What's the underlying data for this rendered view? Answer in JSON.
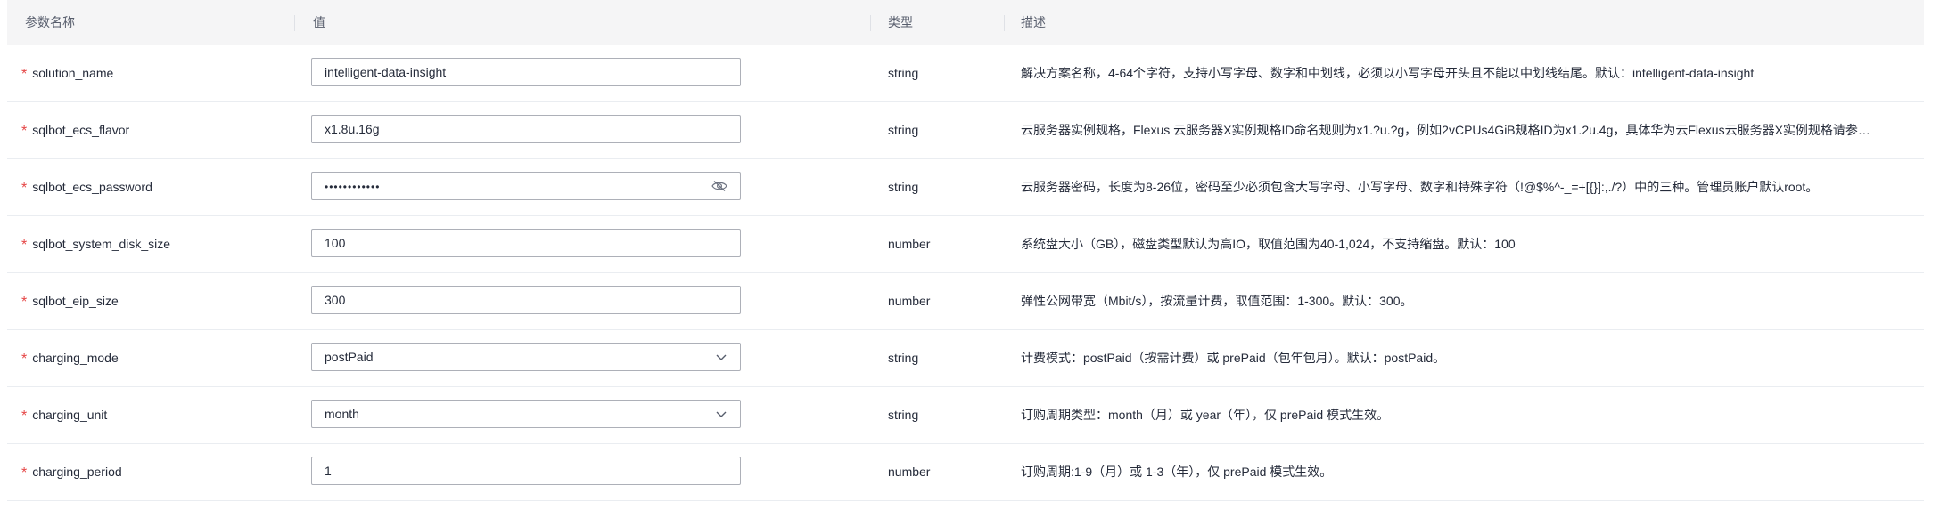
{
  "header": {
    "col_name": "参数名称",
    "col_value": "值",
    "col_type": "类型",
    "col_desc": "描述"
  },
  "rows": [
    {
      "required_mark": "*",
      "name": "solution_name",
      "value": "intelligent-data-insight",
      "control": "text",
      "type": "string",
      "desc": "解决方案名称，4-64个字符，支持小写字母、数字和中划线，必须以小写字母开头且不能以中划线结尾。默认：intelligent-data-insight"
    },
    {
      "required_mark": "*",
      "name": "sqlbot_ecs_flavor",
      "value": "x1.8u.16g",
      "control": "text",
      "type": "string",
      "desc": "云服务器实例规格，Flexus 云服务器X实例规格ID命名规则为x1.?u.?g，例如2vCPUs4GiB规格ID为x1.2u.4g，具体华为云Flexus云服务器X实例规格请参…"
    },
    {
      "required_mark": "*",
      "name": "sqlbot_ecs_password",
      "value": "••••••••••••",
      "control": "password",
      "type": "string",
      "desc": "云服务器密码，长度为8-26位，密码至少必须包含大写字母、小写字母、数字和特殊字符（!@$%^-_=+[{}]:,./?）中的三种。管理员账户默认root。"
    },
    {
      "required_mark": "*",
      "name": "sqlbot_system_disk_size",
      "value": "100",
      "control": "text",
      "type": "number",
      "desc": "系统盘大小（GB），磁盘类型默认为高IO，取值范围为40-1,024，不支持缩盘。默认：100"
    },
    {
      "required_mark": "*",
      "name": "sqlbot_eip_size",
      "value": "300",
      "control": "text",
      "type": "number",
      "desc": "弹性公网带宽（Mbit/s），按流量计费，取值范围：1-300。默认：300。"
    },
    {
      "required_mark": "*",
      "name": "charging_mode",
      "value": "postPaid",
      "control": "select",
      "type": "string",
      "desc": "计费模式：postPaid（按需计费）或 prePaid（包年包月）。默认：postPaid。"
    },
    {
      "required_mark": "*",
      "name": "charging_unit",
      "value": "month",
      "control": "select",
      "type": "string",
      "desc": "订购周期类型：month（月）或 year（年），仅 prePaid 模式生效。"
    },
    {
      "required_mark": "*",
      "name": "charging_period",
      "value": "1",
      "control": "text",
      "type": "number",
      "desc": "订购周期:1-9（月）或 1-3（年），仅 prePaid 模式生效。"
    }
  ],
  "icons": {
    "password_toggle": "eye-off-icon",
    "select_arrow": "chevron-down-icon"
  },
  "colors": {
    "required": "#e54545",
    "header_bg": "#f5f5f6",
    "border": "#adb0b8"
  }
}
